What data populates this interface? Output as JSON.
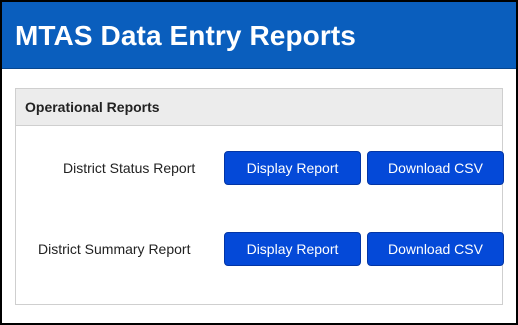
{
  "header": {
    "title": "MTAS Data Entry Reports",
    "background_color": "#0a5ebd"
  },
  "panel": {
    "heading": "Operational Reports",
    "reports": [
      {
        "label": "District Status Report",
        "display_button": "Display Report",
        "download_button": "Download CSV"
      },
      {
        "label": "District Summary Report",
        "display_button": "Display Report",
        "download_button": "Download CSV"
      }
    ]
  },
  "colors": {
    "button": "#0449d8",
    "panel_heading": "#ececec"
  }
}
